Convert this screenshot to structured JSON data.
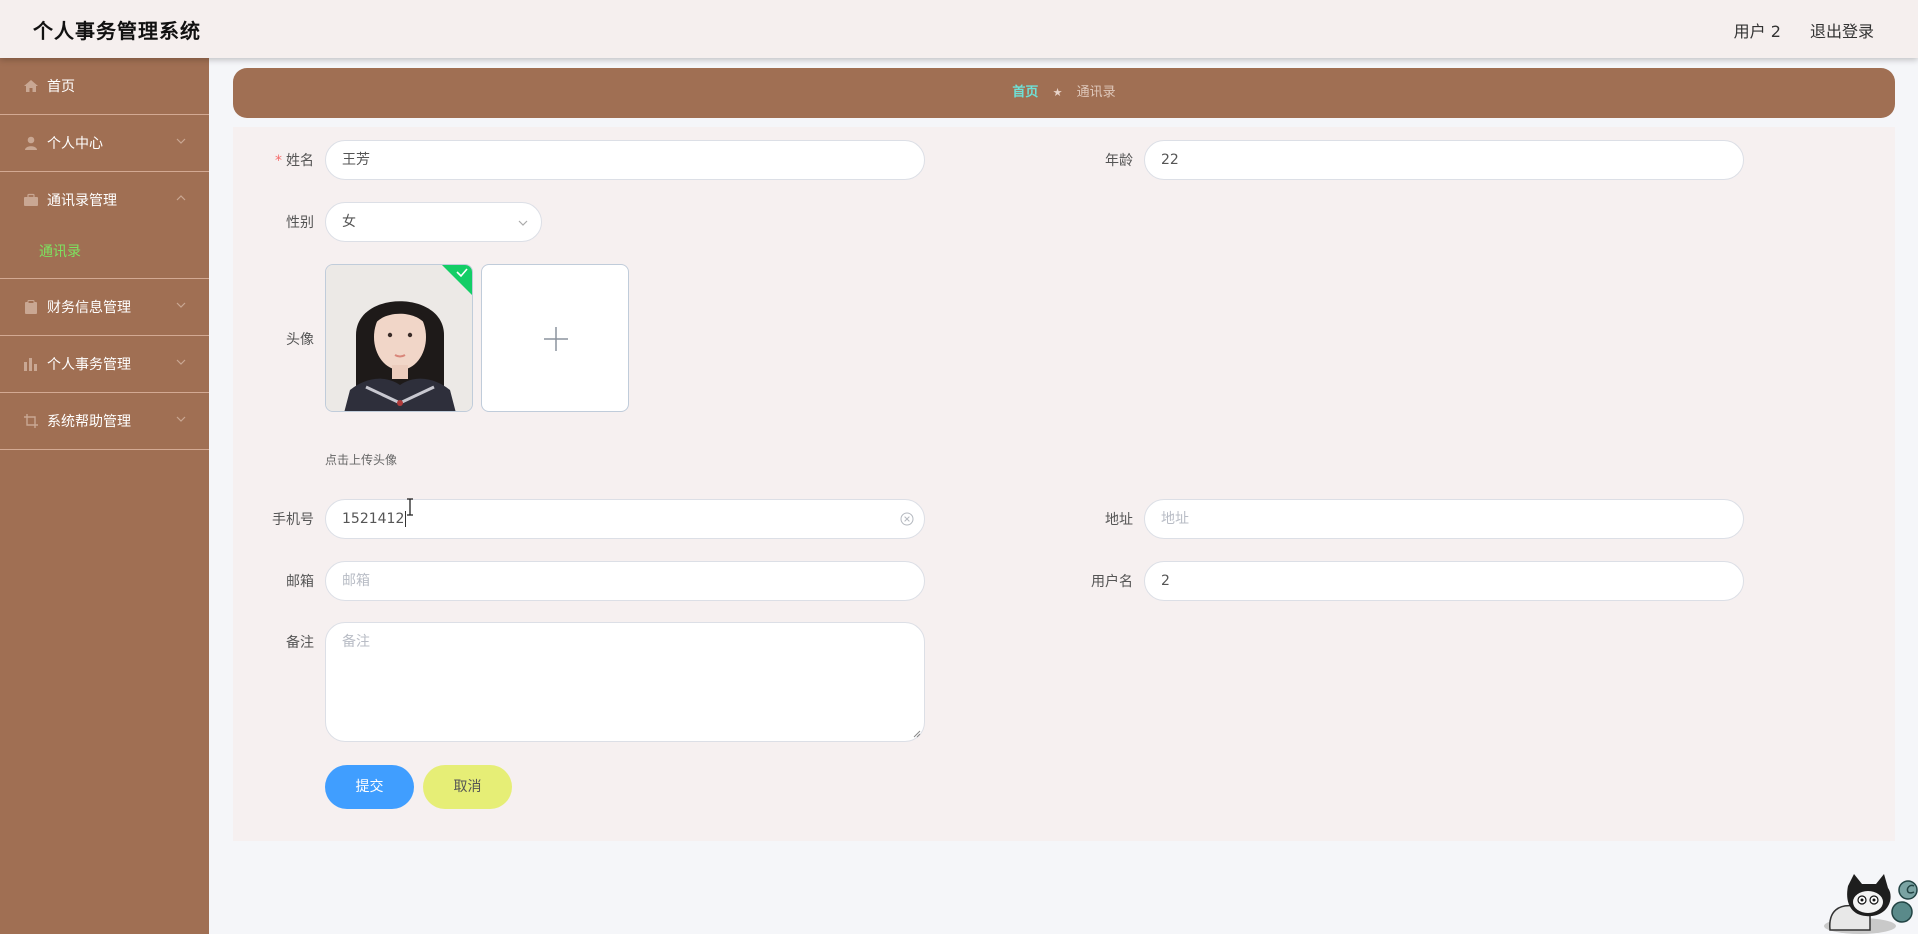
{
  "header": {
    "title": "个人事务管理系统",
    "user": "用户 2",
    "logout": "退出登录"
  },
  "sidebar": {
    "items": [
      {
        "label": "首页",
        "icon": "home-icon"
      },
      {
        "label": "个人中心",
        "icon": "user-icon"
      },
      {
        "label": "通讯录管理",
        "icon": "briefcase-icon",
        "sub": "通讯录"
      },
      {
        "label": "财务信息管理",
        "icon": "clipboard-icon"
      },
      {
        "label": "个人事务管理",
        "icon": "chart-icon"
      },
      {
        "label": "系统帮助管理",
        "icon": "crop-icon"
      }
    ]
  },
  "breadcrumb": {
    "home": "首页",
    "current": "通讯录",
    "separator": "★"
  },
  "form": {
    "name": {
      "label": "姓名",
      "value": "王芳"
    },
    "age": {
      "label": "年龄",
      "value": "22"
    },
    "gender": {
      "label": "性别",
      "value": "女"
    },
    "avatar": {
      "label": "头像",
      "tip": "点击上传头像"
    },
    "phone": {
      "label": "手机号",
      "value": "1521412"
    },
    "address": {
      "label": "地址",
      "placeholder": "地址"
    },
    "email": {
      "label": "邮箱",
      "placeholder": "邮箱"
    },
    "username": {
      "label": "用户名",
      "value": "2"
    },
    "remark": {
      "label": "备注",
      "placeholder": "备注"
    },
    "submit": "提交",
    "cancel": "取消"
  },
  "colors": {
    "sidebar": "#a06f53",
    "active_sub": "#7de360",
    "submit": "#409eff",
    "cancel": "#e6ee76"
  }
}
